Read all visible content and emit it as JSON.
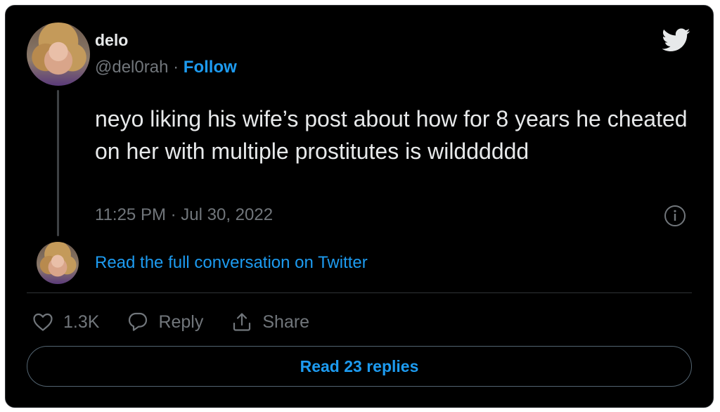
{
  "author": {
    "name": "delo",
    "handle": "@del0rah",
    "separator": "·",
    "follow_label": "Follow"
  },
  "tweet": {
    "text": "neyo liking his wife’s post about how for 8 years he cheated on her with multiple prostitutes is wildddddd",
    "timestamp": "11:25 PM · Jul 30, 2022"
  },
  "conversation_link": "Read the full conversation on Twitter",
  "actions": {
    "like_count": "1.3K",
    "reply_label": "Reply",
    "share_label": "Share"
  },
  "read_replies_label": "Read 23 replies",
  "icons": {
    "brand": "twitter-bird-icon",
    "info": "info-icon",
    "like": "heart-icon",
    "reply": "reply-bubble-icon",
    "share": "share-icon"
  },
  "colors": {
    "background": "#000000",
    "text": "#e7e9ea",
    "muted": "#71767b",
    "accent": "#1d9bf0"
  }
}
